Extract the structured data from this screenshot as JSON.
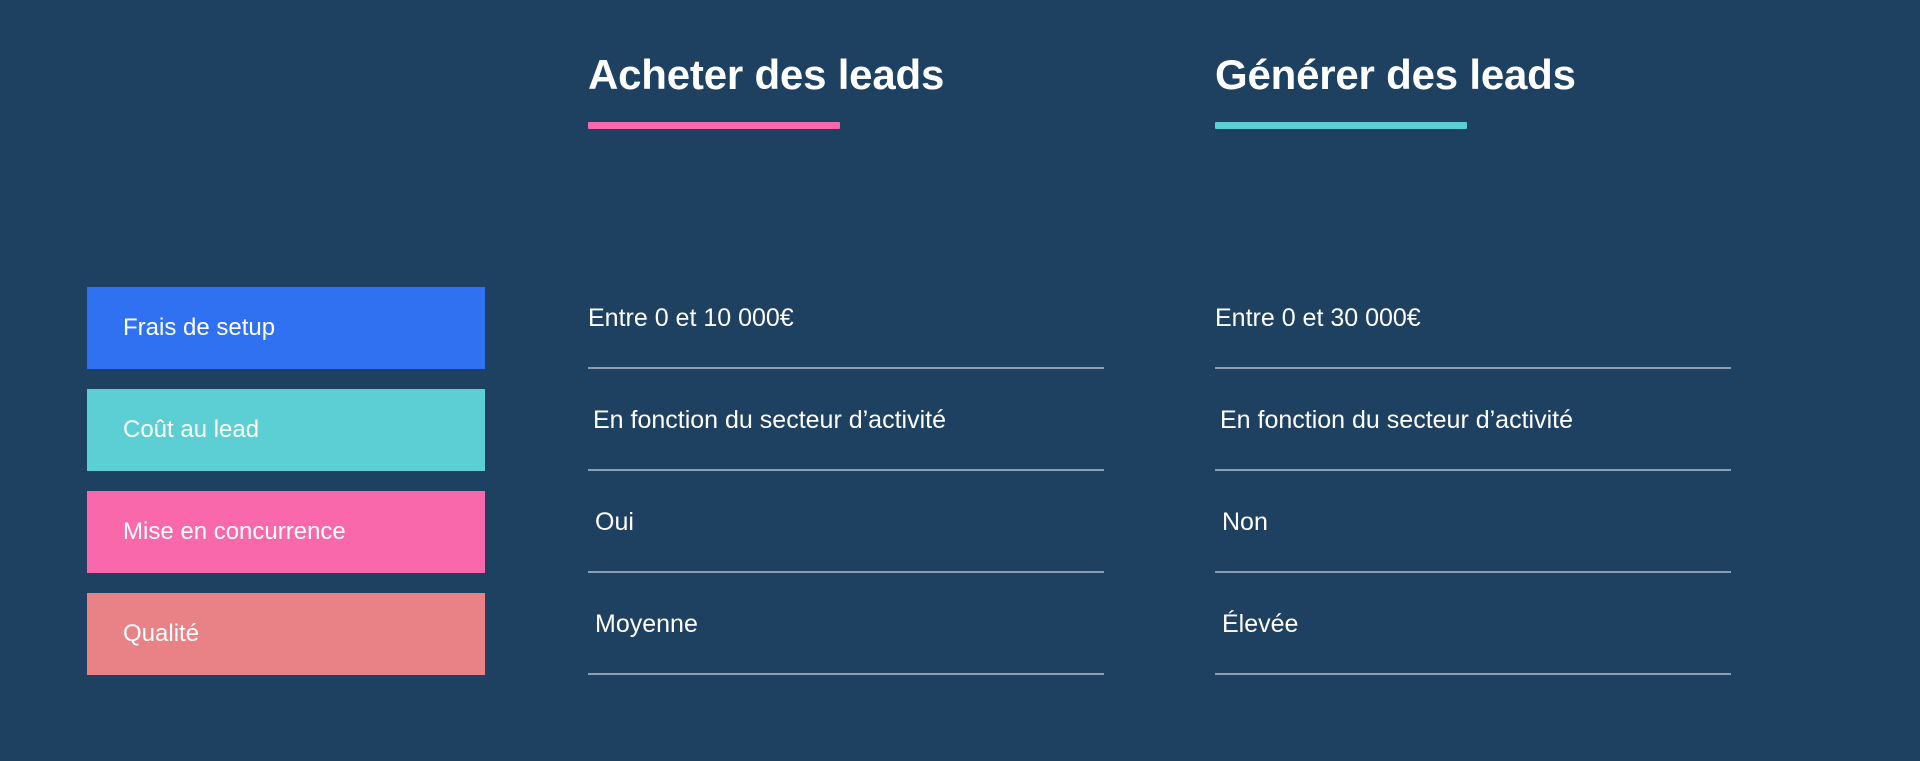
{
  "theme": {
    "background": "#1e4162",
    "text": "#ffffff",
    "divider": "#8e9eb1"
  },
  "columns": [
    {
      "title": "Acheter des leads",
      "accent": "#fa68ac"
    },
    {
      "title": "Générer des leads",
      "accent": "#5bcfd4"
    }
  ],
  "criteria": [
    {
      "label": "Frais de setup",
      "color": "#2f71f0"
    },
    {
      "label": "Coût au lead",
      "color": "#5bcfd4"
    },
    {
      "label": "Mise en concurrence",
      "color": "#fa68ac"
    },
    {
      "label": "Qualité",
      "color": "#e88287"
    }
  ],
  "values": {
    "buy": [
      "Entre 0 et 10 000€",
      "En fonction du secteur d’activité",
      "Oui",
      "Moyenne"
    ],
    "generate": [
      "Entre 0 et 30 000€",
      "En fonction du secteur d’activité",
      "Non",
      "Élevée"
    ]
  }
}
